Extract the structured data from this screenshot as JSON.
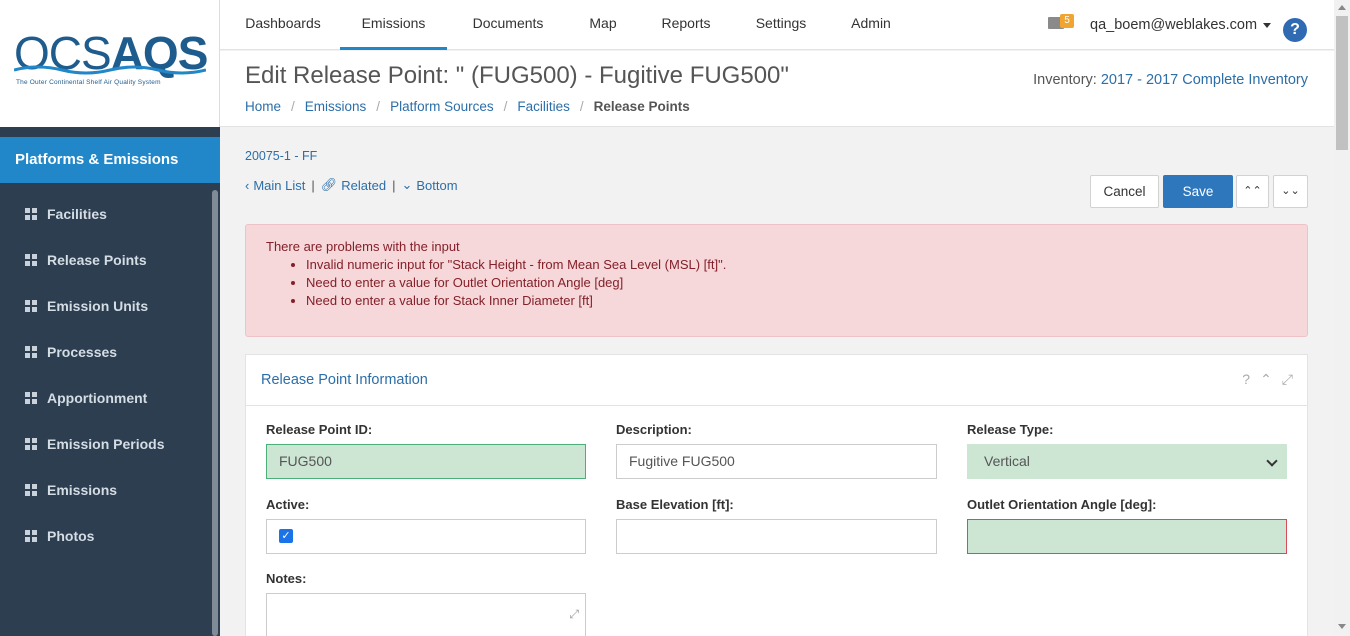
{
  "logo": {
    "part1": "OCS",
    "part2": "AQS",
    "tagline": "The Outer Continental Shelf Air Quality System"
  },
  "sidebar": {
    "header": "Platforms & Emissions",
    "items": [
      {
        "label": "Facilities"
      },
      {
        "label": "Release Points"
      },
      {
        "label": "Emission Units"
      },
      {
        "label": "Processes"
      },
      {
        "label": "Apportionment"
      },
      {
        "label": "Emission Periods"
      },
      {
        "label": "Emissions"
      },
      {
        "label": "Photos"
      }
    ]
  },
  "nav": {
    "tabs": [
      {
        "label": "Dashboards"
      },
      {
        "label": "Emissions"
      },
      {
        "label": "Documents"
      },
      {
        "label": "Map"
      },
      {
        "label": "Reports"
      },
      {
        "label": "Settings"
      },
      {
        "label": "Admin"
      }
    ],
    "active_tab": "Emissions",
    "mail_count": "5",
    "user": "qa_boem@weblakes.com",
    "help": "?"
  },
  "header": {
    "title": "Edit Release Point: \" (FUG500) - Fugitive FUG500\"",
    "inventory_label": "Inventory:",
    "inventory_value": "2017 - 2017 Complete Inventory",
    "breadcrumb": [
      "Home",
      "Emissions",
      "Platform Sources",
      "Facilities"
    ],
    "breadcrumb_current": "Release Points"
  },
  "content": {
    "sub_id": "20075-1 - FF",
    "links": {
      "main_list": "Main List",
      "related": "Related",
      "bottom": "Bottom"
    },
    "buttons": {
      "cancel": "Cancel",
      "save": "Save"
    }
  },
  "alert": {
    "title": "There are problems with the input",
    "items": [
      "Invalid numeric input for \"Stack Height - from Mean Sea Level (MSL) [ft]\".",
      "Need to enter a value for Outlet Orientation Angle [deg]",
      "Need to enter a value for Stack Inner Diameter [ft]"
    ]
  },
  "panel": {
    "title": "Release Point Information",
    "fields": {
      "release_point_id": {
        "label": "Release Point ID:",
        "value": "FUG500"
      },
      "description": {
        "label": "Description:",
        "value": "Fugitive FUG500"
      },
      "release_type": {
        "label": "Release Type:",
        "value": "Vertical"
      },
      "active": {
        "label": "Active:",
        "checked": true
      },
      "base_elevation": {
        "label": "Base Elevation [ft]:",
        "value": ""
      },
      "outlet_angle": {
        "label": "Outlet Orientation Angle [deg]:",
        "value": ""
      },
      "notes": {
        "label": "Notes:",
        "value": ""
      }
    }
  },
  "colors": {
    "accent": "#2187c9",
    "sidebar": "#2d3e50",
    "primary_button": "#2f77bd",
    "alert_bg": "#f6d7da",
    "valid_field": "#cde5d3"
  }
}
